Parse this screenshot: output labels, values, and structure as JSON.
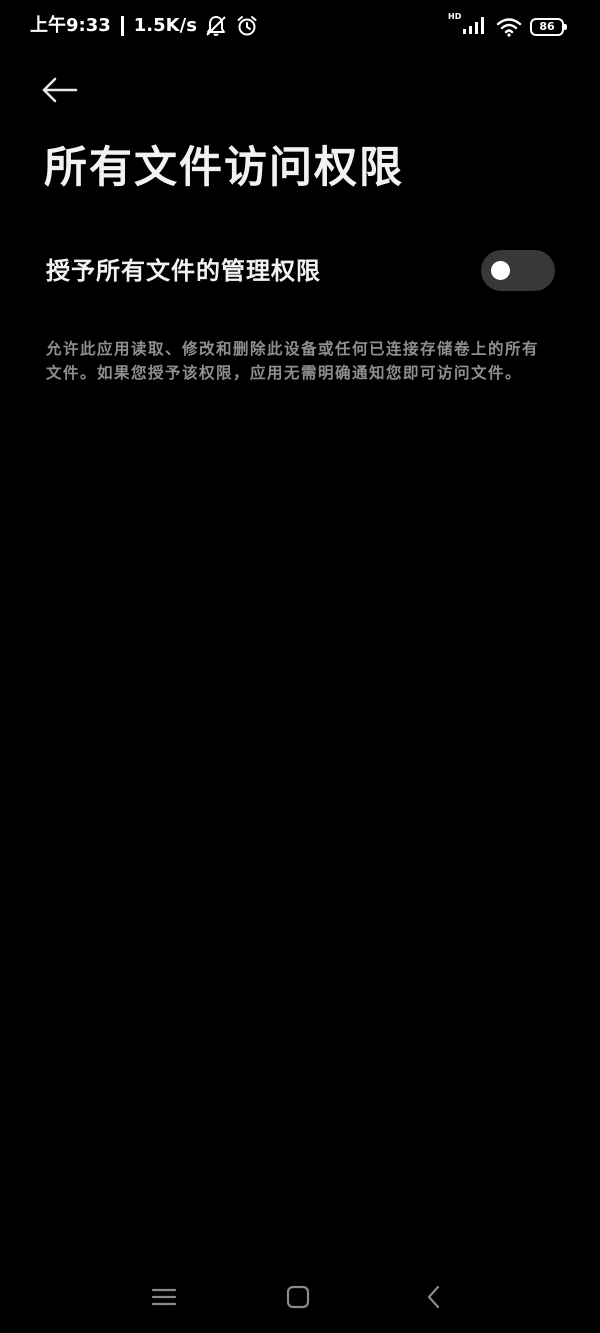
{
  "status_bar": {
    "time": "上午9:33",
    "network_speed": "1.5K/s",
    "network_type": "HD",
    "battery_level": "86",
    "icons": [
      "mute-bell-icon",
      "alarm-icon",
      "signal-icon",
      "wifi-icon",
      "battery-icon"
    ]
  },
  "page": {
    "title": "所有文件访问权限",
    "back_icon": "arrow-left-icon"
  },
  "setting": {
    "label": "授予所有文件的管理权限",
    "toggle_state": "off",
    "description": "允许此应用读取、修改和删除此设备或任何已连接存储卷上的所有文件。如果您授予该权限，应用无需明确通知您即可访问文件。"
  },
  "nav_bar": {
    "icons": [
      "menu-icon",
      "home-icon",
      "back-icon"
    ]
  },
  "colors": {
    "background": "#000000",
    "text_primary": "#f2f2f2",
    "text_secondary": "#8f8f8f",
    "toggle_track": "#383838",
    "toggle_knob": "#ffffff"
  }
}
